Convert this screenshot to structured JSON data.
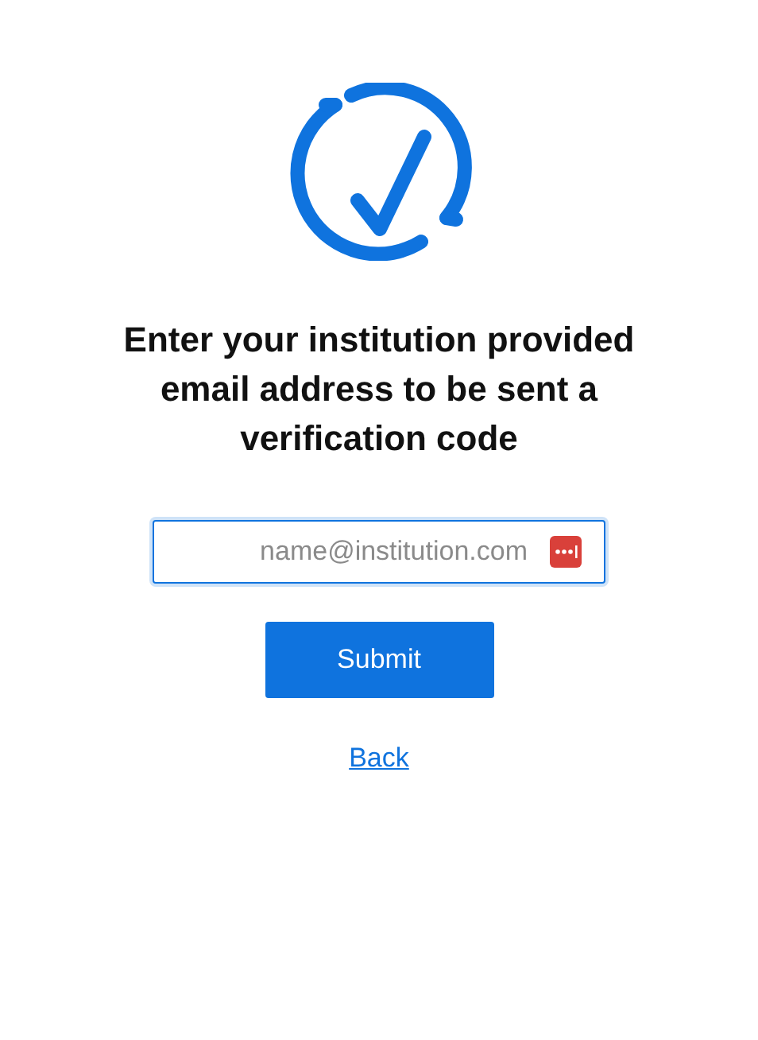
{
  "heading": "Enter your institution provided email address to be sent a verification code",
  "email_field": {
    "placeholder": "name@institution.com"
  },
  "submit_button": "Submit",
  "back_link": "Back"
}
